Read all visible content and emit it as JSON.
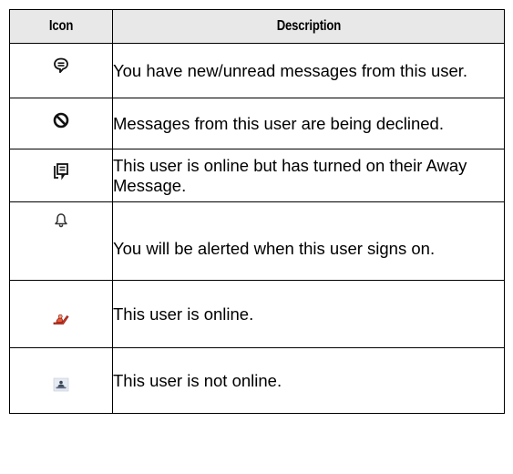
{
  "table": {
    "headers": {
      "icon": "Icon",
      "description": "Description"
    },
    "rows": [
      {
        "icon": "unread-message-icon",
        "description": "You have new/unread messages from this user."
      },
      {
        "icon": "decline-icon",
        "description": "Messages from this user are being declined."
      },
      {
        "icon": "away-message-icon",
        "description": "This user is online but has turned on their Away Message."
      },
      {
        "icon": "alert-bell-icon",
        "description": "You will be alerted when this user signs on."
      },
      {
        "icon": "online-user-icon",
        "description": "This user is online."
      },
      {
        "icon": "offline-user-icon",
        "description": "This user is not online."
      }
    ]
  },
  "colors": {
    "header_background": "#e8e8e8",
    "border": "#000000",
    "online_icon": "#d83a2a",
    "offline_icon": "#5a6a80"
  }
}
